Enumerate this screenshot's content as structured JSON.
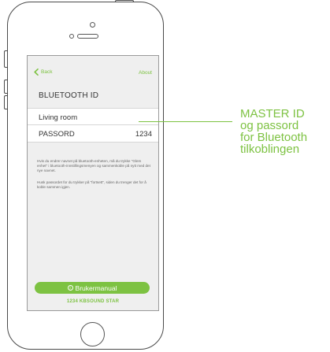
{
  "navbar": {
    "back_label": "Back",
    "about_label": "About"
  },
  "section_title": "BLUETOOTH ID",
  "fields": {
    "device_name": "Living room",
    "password_label": "PASSORD",
    "password_value": "1234"
  },
  "info": {
    "paragraph1": "Hvis du endrer navnet på bluetooth-enheten, må du trykke \"Glem enhet\" i bluetooth-innstillingsmenyen og sammenkoble på nytt med det nye navnet.",
    "paragraph2": "Husk passordet for du trykker på \"fortsett\", siden du trenger det for å koble sammen igjen."
  },
  "manual_button": {
    "icon_glyph": "i",
    "label": "Brukermanual"
  },
  "footer_text": "1234 KBSOUND STAR",
  "callout": {
    "line1": "MASTER ID",
    "line2": "og passord",
    "line3": "for Bluetooth",
    "line4": "tilkoblingen"
  },
  "colors": {
    "accent": "#7dc242",
    "screen_bg": "#efefef",
    "text": "#333333"
  },
  "icons": {
    "back": "chevron-left-icon",
    "manual": "info-icon"
  }
}
